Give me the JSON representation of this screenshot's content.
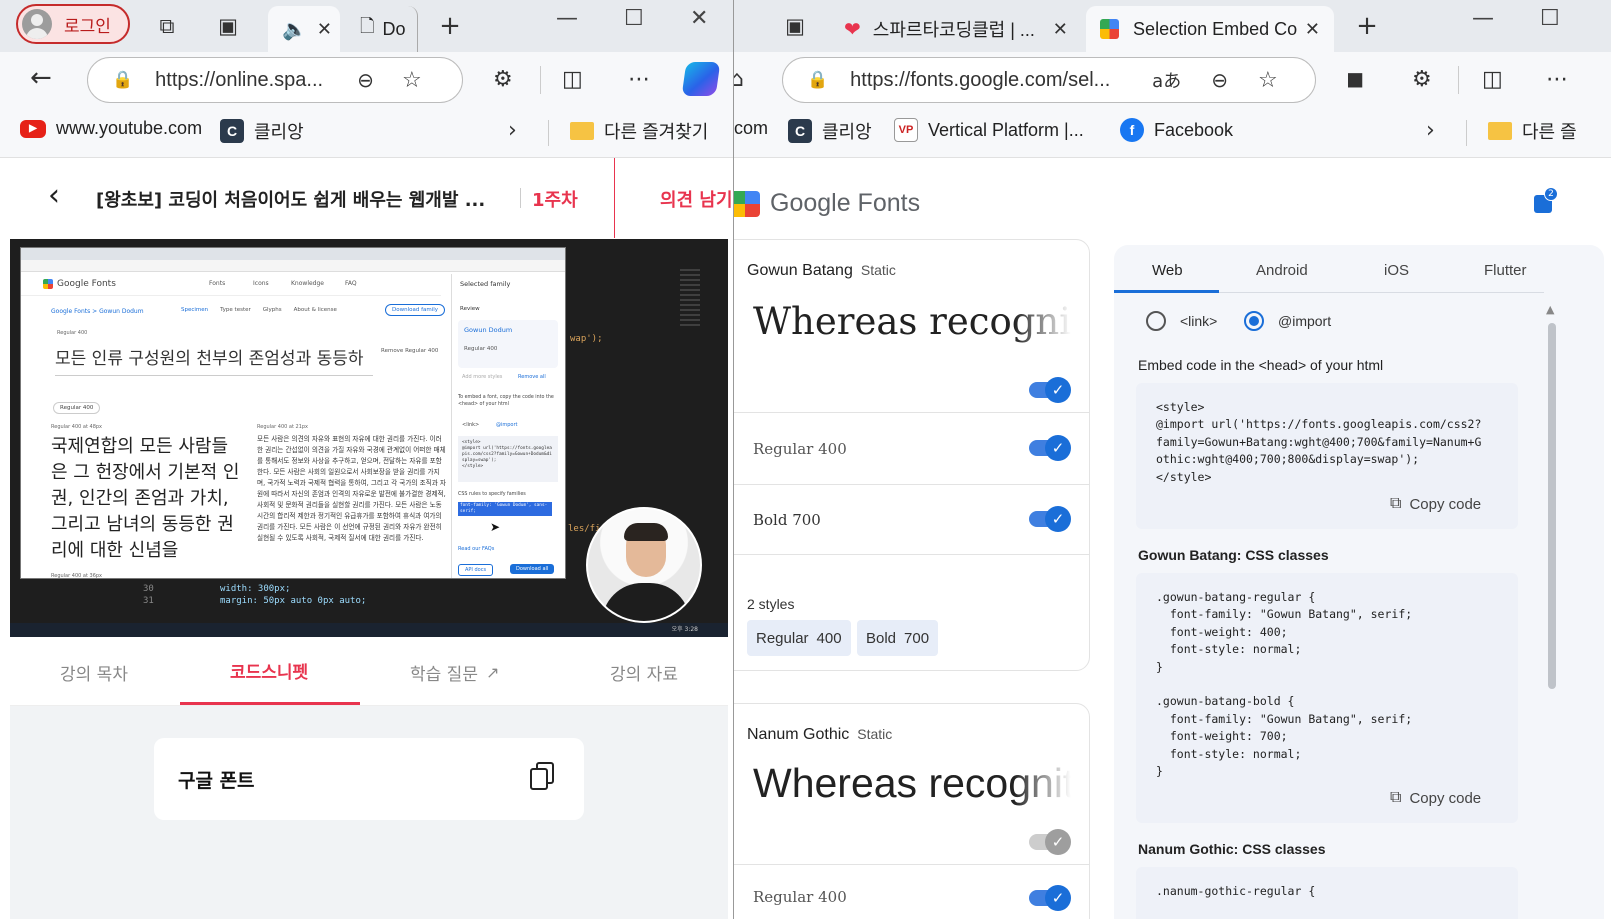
{
  "left_window": {
    "login_label": "로그인",
    "tab_doc_label": "Do",
    "url": "https://online.spa...",
    "bookmarks": [
      "www.youtube.com",
      "클리앙",
      "다른 즐겨찾기"
    ],
    "lecture": {
      "title": "[왕초보] 코딩이 처음이어도 쉽게 배우는 웹개발 ...",
      "week": "1주차",
      "feedback_label": "의견 남기"
    },
    "video": {
      "gf_logo_text": "Google Fonts",
      "nav": [
        "Fonts",
        "Icons",
        "Knowledge",
        "FAQ"
      ],
      "breadcrumb": "Google Fonts > Gowun Dodum",
      "page_tabs": [
        "Specimen",
        "Type tester",
        "Glyphs",
        "About & license"
      ],
      "download_label": "Download family",
      "regular_label": "Regular 400",
      "remove_label": "Remove Regular 400",
      "preview_line": "모든 인류 구성원의 천부의 존엄성과 동등하",
      "style_select": "Regular 400",
      "at48_label": "Regular 400 at 48px",
      "big_text": "국제연합의 모든 사람들은 그 헌장에서 기본적 인권, 인간의 존엄과 가치, 그리고 남녀의 동등한 권리에 대한 신념을",
      "at21_label": "Regular 400 at 21px",
      "small_text": "모든 사람은 의견의 자유와 표현의 자유에 대한 권리를 가진다. 이러한 권리는 간섭없이 의견을 가질 자유와 국경에 관계없이 어떠한 매체를 통해서도 정보와 사상을 추구하고, 얻으며, 전달하는 자유를 포함한다. 모든 사람은 사회의 일원으로서 사회보장을 받을 권리를 가지며, 국가적 노력과 국제적 협력을 통하여, 그리고 각 국가의 조직과 자원에 따라서 자신의 존엄과 인격의 자유로운 발전에 불가결한 경제적, 사회적 및 문화적 권리들을 실현할 권리를 가진다. 모든 사람은 노동시간의 합리적 제한과 정기적인 유급휴가를 포함하여 휴식과 여가의 권리를 가진다. 모든 사람은 이 선언에 규정된 권리와 자유가 완전히 실현될 수 있도록 사회적, 국제적 질서에 대한 권리를 가진다.",
      "at36_label": "Regular 400 at 36px",
      "panel_title": "Selected family",
      "review_label": "Review",
      "family_name": "Gowun Dodum",
      "panel_regular": "Regular 400",
      "add_more": "Add more styles",
      "remove_all": "Remove all",
      "embed_hint": "To embed a font, copy the code into the <head> of your html",
      "opt_link": "<link>",
      "opt_import": "@import",
      "mini_code": "<style>\n@import url('https://fonts.googleapis.com/css2?family=Gowun+Dodum&display=swap');\n</style>",
      "css_rules_label": "CSS rules to specify families",
      "css_rule": "font-family: 'Gowun Dodum', sans-serif;",
      "faq_link": "Read our FAQs",
      "api_docs": "API docs",
      "download_all": "Download all",
      "code_line1": "width: 300px;",
      "code_line2": "margin: 50px auto 0px auto;",
      "code_num1": "30",
      "code_num2": "31",
      "code_frag1": "wap');",
      "code_frag2": "les/fi",
      "time": "오후 3:28",
      "date": "2023-08-18"
    },
    "lecture_tabs": [
      "강의 목차",
      "코드스니펫",
      "학습 질문",
      "강의 자료"
    ],
    "active_tab_index": 1,
    "snippet_title": "구글 폰트"
  },
  "right_window": {
    "tabs": [
      "스파르타코딩클럽 | ...",
      "Selection Embed Co..."
    ],
    "url": "https://fonts.google.com/sel...",
    "bookmarks": [
      "com",
      "클리앙",
      "Vertical Platform |...",
      "Facebook",
      "다른 즐"
    ],
    "gf_logo": "Google Fonts",
    "bag_count": "2",
    "families": [
      {
        "name": "Gowun Batang",
        "kind": "Static",
        "preview": "Whereas recognitio",
        "styles": [
          "Regular 400",
          "Bold 700"
        ],
        "styles_count": "2 styles",
        "chips": [
          {
            "name": "Regular",
            "weight": "400"
          },
          {
            "name": "Bold",
            "weight": "700"
          }
        ]
      },
      {
        "name": "Nanum Gothic",
        "kind": "Static",
        "preview": "Whereas recogniti",
        "first_style": "Regular 400"
      }
    ],
    "platform_tabs": [
      "Web",
      "Android",
      "iOS",
      "Flutter"
    ],
    "radio_link": "<link>",
    "radio_import": "@import",
    "embed_heading": "Embed code in the <head> of your html",
    "embed_code": "<style>\n@import url('https://fonts.googleapis.com/css2?\nfamily=Gowun+Batang:wght@400;700&family=Nanum+G\nothic:wght@400;700;800&display=swap');\n</style>",
    "copy_label": "Copy code",
    "css_heading_1": "Gowun Batang: CSS classes",
    "css_code_1": ".gowun-batang-regular {\n  font-family: \"Gowun Batang\", serif;\n  font-weight: 400;\n  font-style: normal;\n}\n\n.gowun-batang-bold {\n  font-family: \"Gowun Batang\", serif;\n  font-weight: 700;\n  font-style: normal;\n}",
    "css_heading_2": "Nanum Gothic: CSS classes",
    "css_code_2_start": ".nanum-gothic-regular {"
  },
  "colors": {
    "accent_red": "#e8344e",
    "gf_blue": "#1a6ed8",
    "toggle_on": "#3f7fe0"
  }
}
